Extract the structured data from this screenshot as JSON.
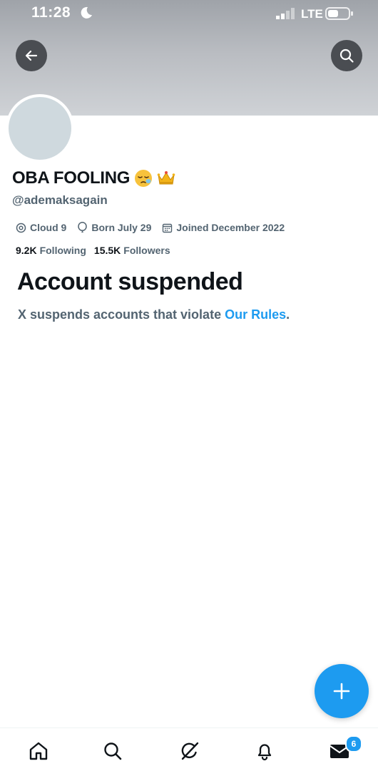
{
  "status_bar": {
    "time": "11:28",
    "network": "LTE"
  },
  "icons": {
    "back": "back-arrow-icon",
    "search": "search-icon",
    "location": "location-icon",
    "birthday": "balloon-icon",
    "calendar": "calendar-icon",
    "compose": "plus-icon",
    "home": "home-icon",
    "explore": "search-icon",
    "grok": "grok-icon",
    "notifications": "bell-icon",
    "messages": "envelope-icon"
  },
  "profile": {
    "display_name": "OBA FOOLING",
    "handle": "@ademaksagain",
    "location": "Cloud 9",
    "birthday": "Born July 29",
    "joined": "Joined December 2022",
    "following_count": "9.2K",
    "following_label": "Following",
    "followers_count": "15.5K",
    "followers_label": "Followers"
  },
  "suspension": {
    "title": "Account suspended",
    "message": "X suspends accounts that violate ",
    "link_text": "Our Rules",
    "suffix": "."
  },
  "nav": {
    "messages_badge": "6"
  },
  "colors": {
    "accent": "#1d9bf0",
    "text": "#0f1419",
    "secondary": "#536471"
  }
}
